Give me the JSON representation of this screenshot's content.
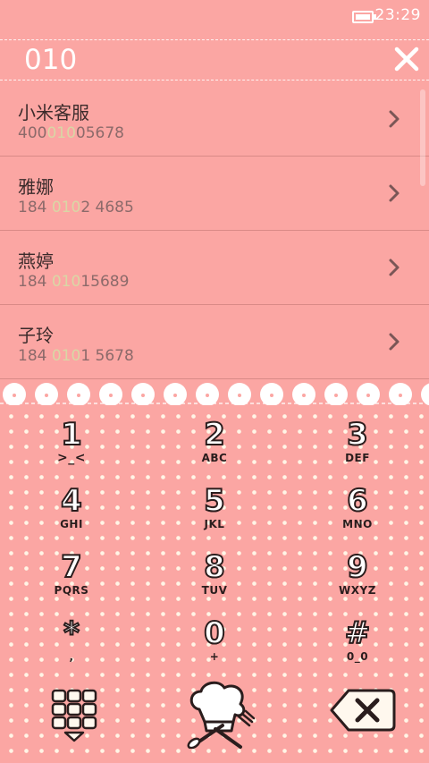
{
  "status": {
    "time": "23:29"
  },
  "search": {
    "query": "010"
  },
  "results": [
    {
      "name": "小米客服",
      "pre": "400",
      "match": "010",
      "post": "05678"
    },
    {
      "name": "雅娜",
      "pre": "184 ",
      "match": "010",
      "post": "2 4685"
    },
    {
      "name": "燕婷",
      "pre": "184 ",
      "match": "010",
      "post": "15689"
    },
    {
      "name": "子玲",
      "pre": "184 ",
      "match": "010",
      "post": "1 5678"
    }
  ],
  "keys": [
    {
      "digit": "1",
      "letters": ">_<"
    },
    {
      "digit": "2",
      "letters": "ABC"
    },
    {
      "digit": "3",
      "letters": "DEF"
    },
    {
      "digit": "4",
      "letters": "GHI"
    },
    {
      "digit": "5",
      "letters": "JKL"
    },
    {
      "digit": "6",
      "letters": "MNO"
    },
    {
      "digit": "7",
      "letters": "PQRS"
    },
    {
      "digit": "8",
      "letters": "TUV"
    },
    {
      "digit": "9",
      "letters": "WXYZ"
    },
    {
      "digit": "*",
      "letters": ","
    },
    {
      "digit": "0",
      "letters": "+"
    },
    {
      "digit": "#",
      "letters": "0_0"
    }
  ],
  "colors": {
    "background": "#fba6a3",
    "highlight": "#d9d7a5",
    "dots": "#fff5e6"
  },
  "icons": {
    "clear": "close-icon",
    "chevron": "chevron-right-icon",
    "keypad_toggle": "keypad-grid-icon",
    "call": "chef-hat-call-icon",
    "delete": "backspace-icon"
  }
}
